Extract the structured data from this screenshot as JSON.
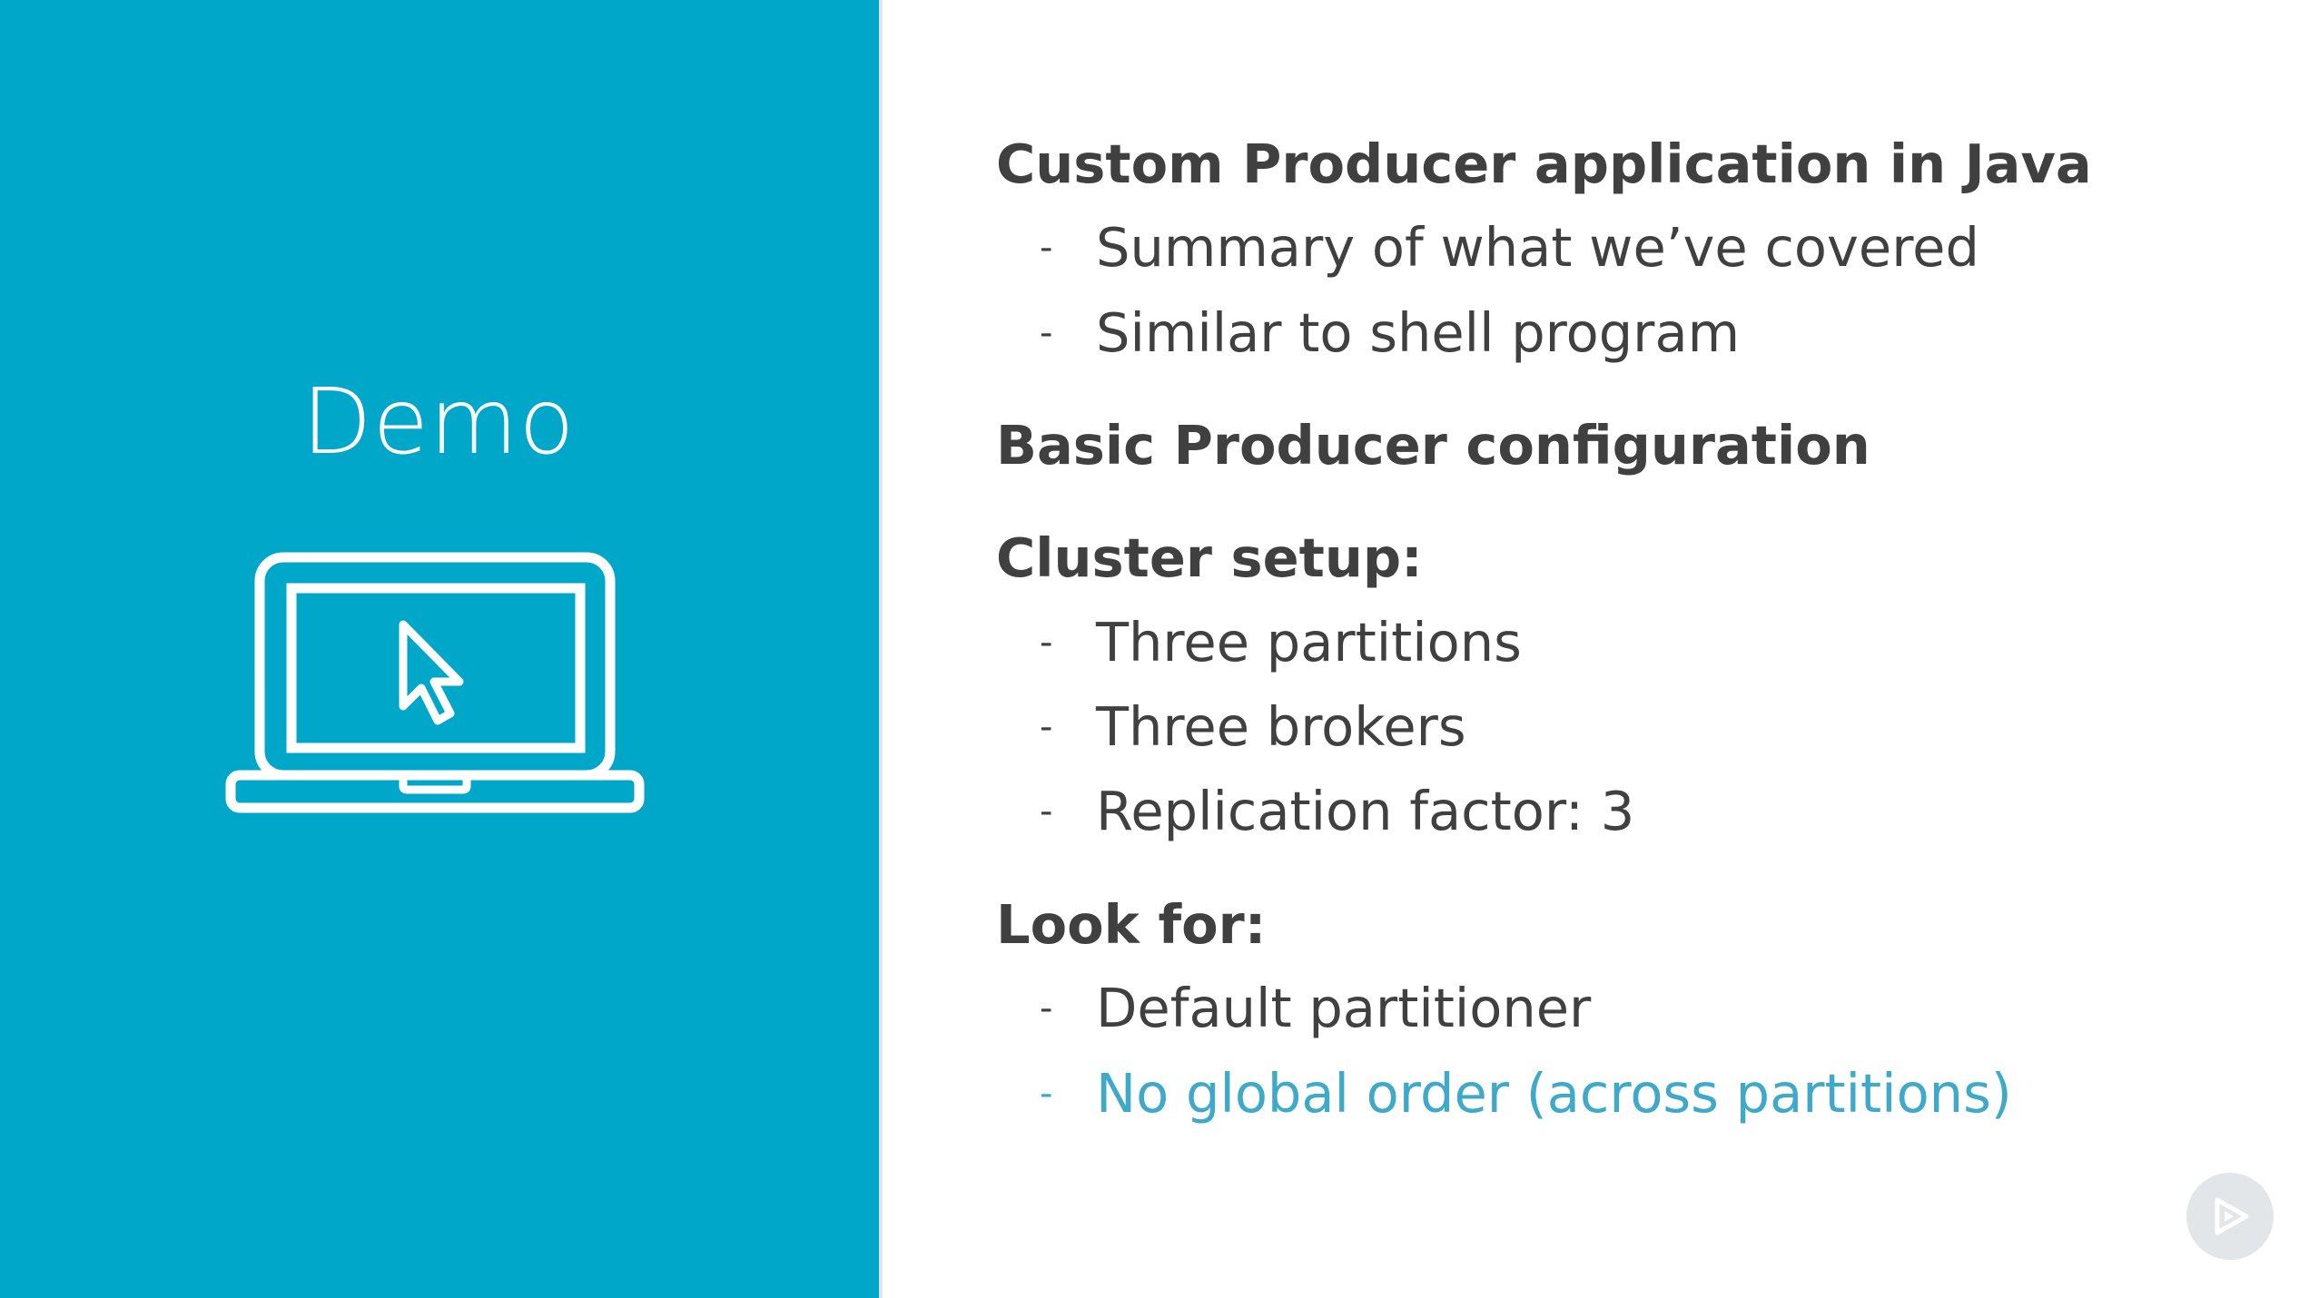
{
  "left_panel": {
    "title": "Demo",
    "icon": "laptop-cursor-icon",
    "background_color": "#00a7c8"
  },
  "content": {
    "sections": [
      {
        "heading": "Custom Producer application in Java",
        "bullets": [
          "Summary of what we’ve covered",
          "Similar to shell program"
        ]
      },
      {
        "heading": "Basic Producer configuration",
        "bullets": []
      },
      {
        "heading": "Cluster setup:",
        "bullets": [
          "Three partitions",
          "Three brokers",
          "Replication factor: 3"
        ]
      },
      {
        "heading": "Look for:",
        "bullets": [
          "Default partitioner",
          "No global order (across partitions)"
        ]
      }
    ],
    "dash": "-",
    "text_color": "#404040",
    "highlight_color": "#3ea9c8"
  },
  "controls": {
    "play_icon": "play-icon"
  }
}
